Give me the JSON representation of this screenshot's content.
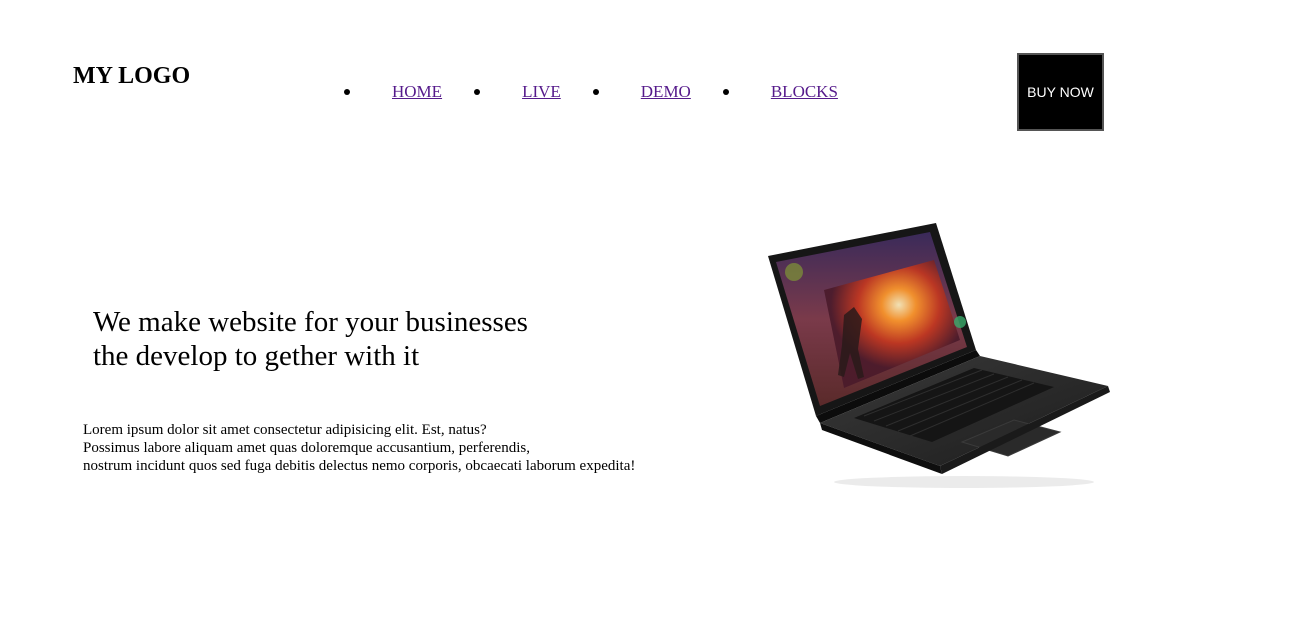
{
  "header": {
    "logo": "MY LOGO",
    "nav": [
      {
        "label": "HOME"
      },
      {
        "label": "LIVE"
      },
      {
        "label": "DEMO"
      },
      {
        "label": "BLOCKS"
      }
    ],
    "cta_label": "BUY NOW"
  },
  "hero": {
    "headline_line1": "We make website for your businesses",
    "headline_line2": "the develop to gether with it",
    "body_lines": [
      "Lorem ipsum dolor sit amet consectetur adipisicing elit. Est, natus?",
      "Possimus labore aliquam amet quas doloremque accusantium, perferendis,",
      "nostrum incidunt quos sed fuga debitis delectus nemo corporis, obcaecati laborum expedita!"
    ]
  },
  "colors": {
    "link": "#551a8b",
    "button_bg": "#000000",
    "button_text": "#ffffff"
  }
}
